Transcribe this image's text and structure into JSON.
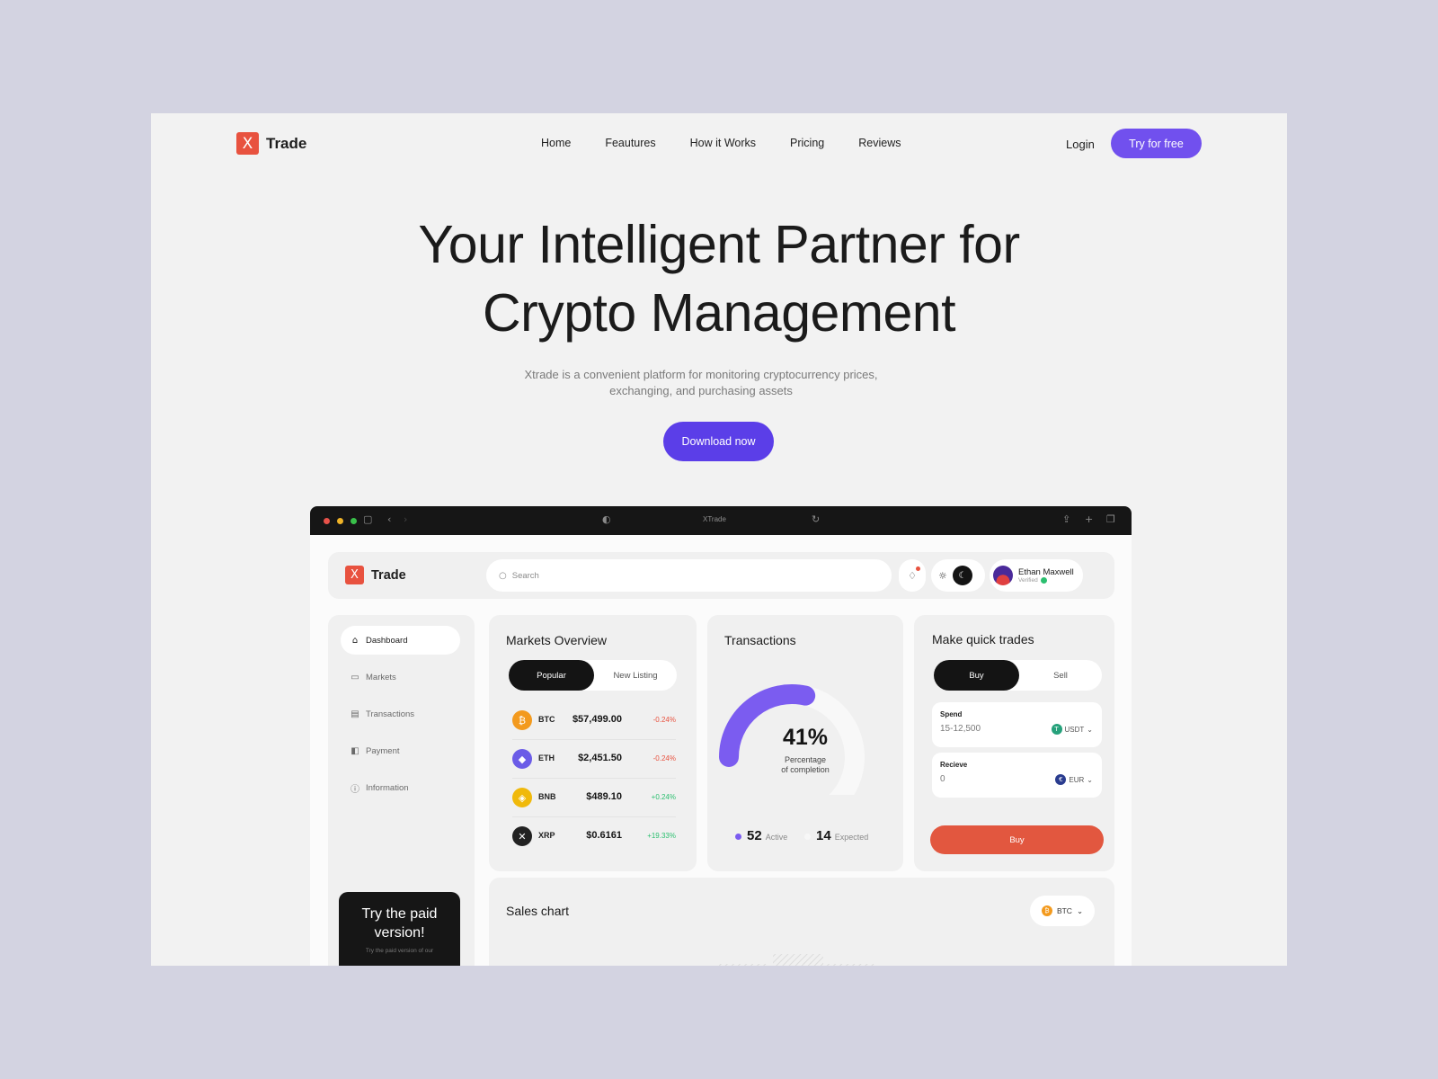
{
  "brand": {
    "mark": "X",
    "name": "Trade"
  },
  "nav": {
    "items": [
      "Home",
      "Feautures",
      "How it Works",
      "Pricing",
      "Reviews"
    ],
    "login": "Login",
    "cta": "Try for free"
  },
  "hero": {
    "title_line1": "Your Intelligent Partner for",
    "title_line2": "Crypto Management",
    "subtitle_line1": "Xtrade is a convenient platform for monitoring cryptocurrency prices,",
    "subtitle_line2": "exchanging, and purchasing assets",
    "cta": "Download now"
  },
  "browser": {
    "url": "XTrade"
  },
  "app": {
    "search_placeholder": "Search",
    "user": {
      "name": "Ethan Maxwell",
      "status": "Verified"
    },
    "sidebar": {
      "items": [
        {
          "label": "Dashboard",
          "icon": "home-icon",
          "active": true
        },
        {
          "label": "Markets",
          "icon": "bag-icon",
          "active": false
        },
        {
          "label": "Transactions",
          "icon": "transactions-icon",
          "active": false
        },
        {
          "label": "Payment",
          "icon": "payment-icon",
          "active": false
        },
        {
          "label": "Information",
          "icon": "info-icon",
          "active": false
        }
      ],
      "promo_title": "Try the paid version!",
      "promo_sub": "Try the paid version of our"
    },
    "markets": {
      "title": "Markets Overview",
      "tabs": [
        "Popular",
        "New Listing"
      ],
      "coins": [
        {
          "symbol": "BTC",
          "price": "$57,499.00",
          "change": "-0.24%",
          "dir": "down",
          "color": "#f39a1e"
        },
        {
          "symbol": "ETH",
          "price": "$2,451.50",
          "change": "-0.24%",
          "dir": "down",
          "color": "#6b5ce7"
        },
        {
          "symbol": "BNB",
          "price": "$489.10",
          "change": "+0.24%",
          "dir": "up",
          "color": "#f0b90b"
        },
        {
          "symbol": "XRP",
          "price": "$0.6161",
          "change": "+19.33%",
          "dir": "up",
          "color": "#222222"
        }
      ]
    },
    "transactions": {
      "title": "Transactions",
      "percent": "41%",
      "percent_value": 0.41,
      "percent_label_1": "Percentage",
      "percent_label_2": "of completion",
      "active_count": "52",
      "active_label": "Active",
      "expected_count": "14",
      "expected_label": "Expected",
      "accent": "#7b5cf0"
    },
    "trades": {
      "title": "Make quick trades",
      "tabs": [
        "Buy",
        "Sell"
      ],
      "spend_label": "Spend",
      "spend_value": "15-12,500",
      "spend_currency": "USDT",
      "receive_label": "Recieve",
      "receive_value": "0",
      "receive_currency": "EUR",
      "button": "Buy"
    },
    "sales": {
      "title": "Sales chart",
      "currency": "BTC"
    }
  }
}
